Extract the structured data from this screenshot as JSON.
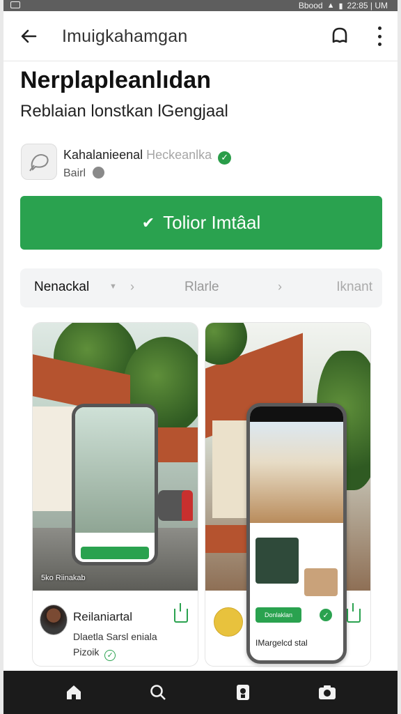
{
  "status_bar": {
    "text": "Bbood",
    "time": "22:85 | UM"
  },
  "app_bar": {
    "title": "Imuigkahamgan"
  },
  "app": {
    "name": "Nerplapleanlıdan",
    "subtitle": "Reblaian lonstkan lGengjaal",
    "developer_name": "Kahalanieenal",
    "developer_extra": "Heckeanlka",
    "developer_sub": "Bairl",
    "install_label": "Tolior Imtâal"
  },
  "tabs": [
    {
      "label": "Nenackal"
    },
    {
      "label": "Rlarle"
    },
    {
      "label": "Iknant"
    }
  ],
  "cards": [
    {
      "caption": "5ko Riinakab",
      "title": "Reilaniartal",
      "line1": "Dlaetla Sarsl eniala",
      "line2": "Pizoik"
    },
    {
      "preview_btn": "Donlaklan",
      "preview_label": "IMargelcd stal"
    }
  ],
  "icons": {
    "back": "arrow-left-icon",
    "bell": "bell-icon",
    "more": "more-vertical-icon",
    "home": "home-icon",
    "search": "search-icon",
    "library": "library-icon",
    "camera": "camera-icon"
  },
  "colors": {
    "accent": "#2aa24f",
    "nav_bg": "#1b1b1b"
  }
}
